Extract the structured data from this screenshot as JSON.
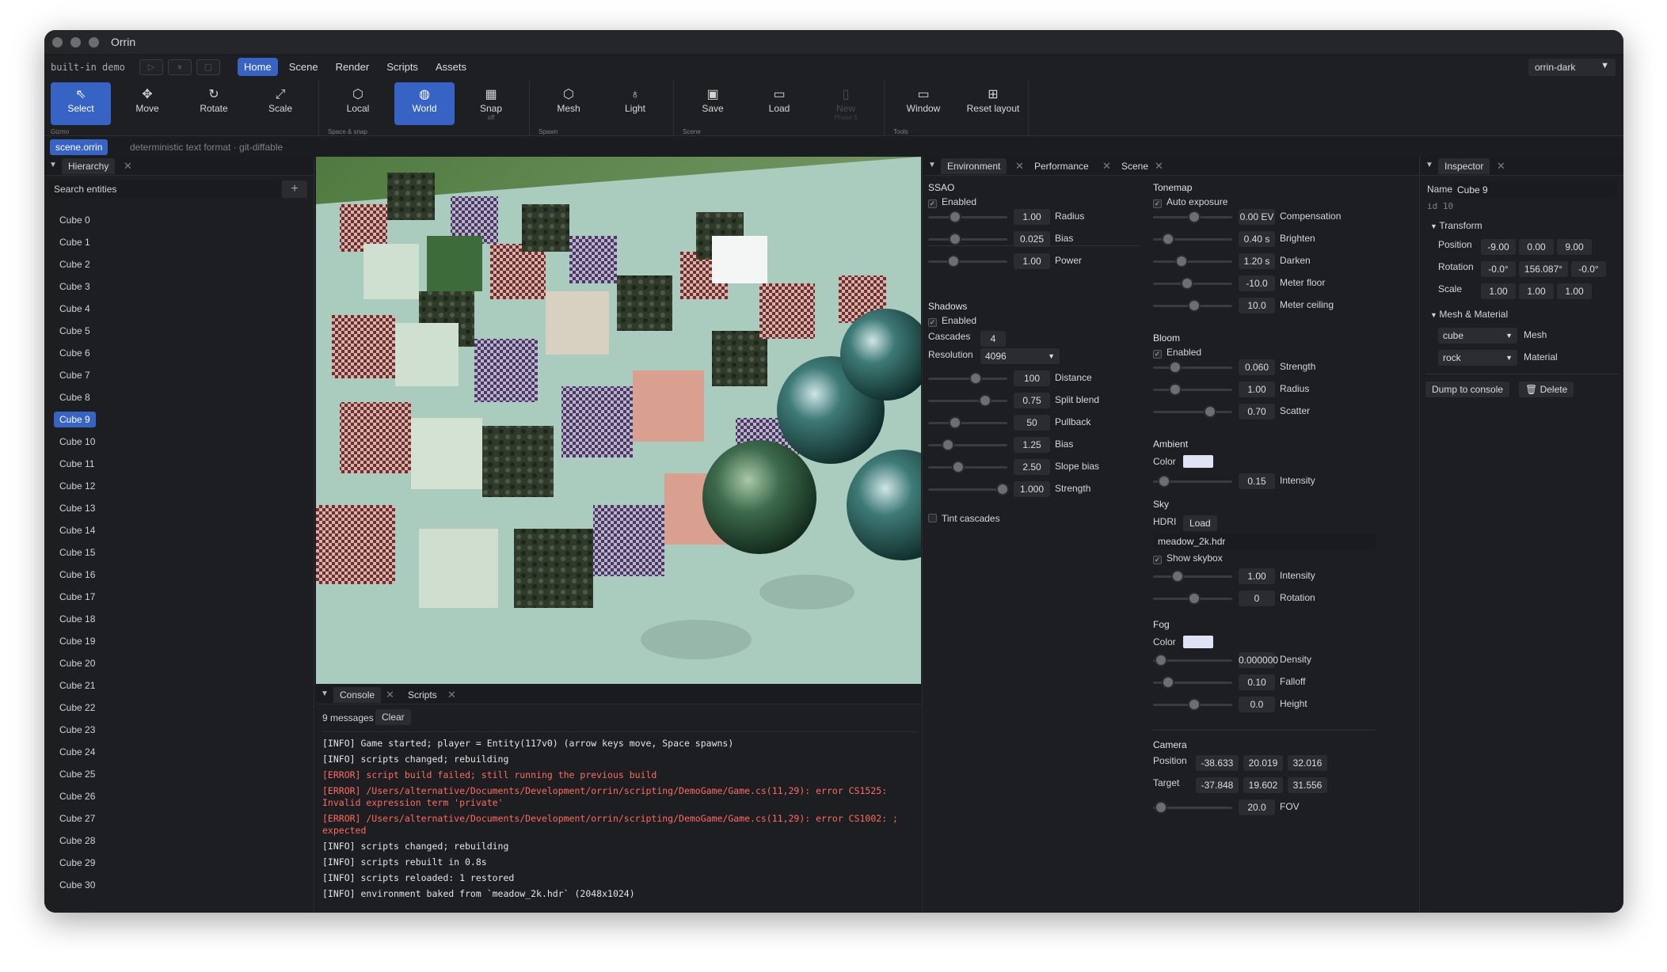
{
  "window": {
    "title": "Orrin"
  },
  "menubar": {
    "brand": "built-in demo",
    "menus": [
      "Home",
      "Scene",
      "Render",
      "Scripts",
      "Assets"
    ],
    "theme": "orrin-dark"
  },
  "ribbon": {
    "select": "Select",
    "move": "Move",
    "rotate": "Rotate",
    "scale": "Scale",
    "local": "Local",
    "world": "World",
    "snap": "Snap",
    "snap_sub": "off",
    "mesh": "Mesh",
    "light": "Light",
    "save": "Save",
    "load": "Load",
    "new": "New",
    "new_sub": "Phase 5",
    "window": "Window",
    "reset_layout": "Reset layout",
    "groups": {
      "gizmo": "Gizmo",
      "space": "Space & snap",
      "spawn": "Spawn",
      "scene": "Scene",
      "tools": "Tools"
    }
  },
  "filebar": {
    "tab": "scene.orrin",
    "note": "deterministic text format · git-diffable"
  },
  "hierarchy": {
    "tab": "Hierarchy",
    "search_placeholder": "Search entities",
    "items": [
      "Cube 0",
      "Cube 1",
      "Cube 2",
      "Cube 3",
      "Cube 4",
      "Cube 5",
      "Cube 6",
      "Cube 7",
      "Cube 8",
      "Cube 9",
      "Cube 10",
      "Cube 11",
      "Cube 12",
      "Cube 13",
      "Cube 14",
      "Cube 15",
      "Cube 16",
      "Cube 17",
      "Cube 18",
      "Cube 19",
      "Cube 20",
      "Cube 21",
      "Cube 22",
      "Cube 23",
      "Cube 24",
      "Cube 25",
      "Cube 26",
      "Cube 27",
      "Cube 28",
      "Cube 29",
      "Cube 30"
    ],
    "selected": "Cube 9"
  },
  "console": {
    "tabs": [
      "Console",
      "Scripts"
    ],
    "count": "9 messages",
    "clear": "Clear",
    "lines": [
      {
        "level": "info",
        "text": "[INFO] Game started; player = Entity(117v0) (arrow keys move, Space spawns)"
      },
      {
        "level": "info",
        "text": "[INFO] scripts changed; rebuilding"
      },
      {
        "level": "error",
        "text": "[ERROR] script build failed; still running the previous build"
      },
      {
        "level": "error",
        "text": "[ERROR] /Users/alternative/Documents/Development/orrin/scripting/DemoGame/Game.cs(11,29): error CS1525: Invalid expression term 'private'"
      },
      {
        "level": "error",
        "text": "[ERROR] /Users/alternative/Documents/Development/orrin/scripting/DemoGame/Game.cs(11,29): error CS1002: ; expected"
      },
      {
        "level": "info",
        "text": "[INFO] scripts changed; rebuilding"
      },
      {
        "level": "info",
        "text": "[INFO] scripts rebuilt in 0.8s"
      },
      {
        "level": "info",
        "text": "[INFO] scripts reloaded: 1 restored"
      },
      {
        "level": "info",
        "text": "[INFO] environment baked from `meadow_2k.hdr` (2048x1024)"
      }
    ]
  },
  "environment": {
    "tabs": [
      "Environment",
      "Performance",
      "Scene"
    ],
    "ssao": {
      "title": "SSAO",
      "enabled": "Enabled",
      "sliders": [
        {
          "label": "Radius",
          "value": "1.00",
          "pos": 0.28
        },
        {
          "label": "Bias",
          "value": "0.025",
          "pos": 0.28
        },
        {
          "label": "Power",
          "value": "1.00",
          "pos": 0.26
        }
      ]
    },
    "shadows": {
      "title": "Shadows",
      "enabled": "Enabled",
      "cascades_label": "Cascades",
      "cascades": "4",
      "resolution_label": "Resolution",
      "resolution": "4096",
      "sliders": [
        {
          "label": "Distance",
          "value": "100",
          "pos": 0.56
        },
        {
          "label": "Split blend",
          "value": "0.75",
          "pos": 0.7
        },
        {
          "label": "Pullback",
          "value": "50",
          "pos": 0.28
        },
        {
          "label": "Bias",
          "value": "1.25",
          "pos": 0.18
        },
        {
          "label": "Slope bias",
          "value": "2.50",
          "pos": 0.33
        },
        {
          "label": "Strength",
          "value": "1.000",
          "pos": 0.93
        }
      ],
      "tint": "Tint cascades"
    },
    "tonemap": {
      "title": "Tonemap",
      "auto": "Auto exposure",
      "sliders": [
        {
          "label": "Compensation",
          "value": "0.00 EV",
          "pos": 0.48
        },
        {
          "label": "Brighten",
          "value": "0.40 s",
          "pos": 0.12
        },
        {
          "label": "Darken",
          "value": "1.20 s",
          "pos": 0.3
        },
        {
          "label": "Meter floor",
          "value": "-10.0",
          "pos": 0.38
        },
        {
          "label": "Meter ceiling",
          "value": "10.0",
          "pos": 0.48
        }
      ]
    },
    "bloom": {
      "title": "Bloom",
      "enabled": "Enabled",
      "sliders": [
        {
          "label": "Strength",
          "value": "0.060",
          "pos": 0.22
        },
        {
          "label": "Radius",
          "value": "1.00",
          "pos": 0.22
        },
        {
          "label": "Scatter",
          "value": "0.70",
          "pos": 0.7
        }
      ]
    },
    "ambient": {
      "title": "Ambient",
      "color_label": "Color",
      "color": "#dfe3f5",
      "intensity": {
        "label": "Intensity",
        "value": "0.15",
        "pos": 0.07
      }
    },
    "sky": {
      "title": "Sky",
      "hdri_label": "HDRI",
      "load": "Load",
      "file": "meadow_2k.hdr",
      "show": "Show skybox",
      "sliders": [
        {
          "label": "Intensity",
          "value": "1.00",
          "pos": 0.25
        },
        {
          "label": "Rotation",
          "value": "0",
          "pos": 0.48
        }
      ]
    },
    "fog": {
      "title": "Fog",
      "color_label": "Color",
      "color": "#dfe3f5",
      "sliders": [
        {
          "label": "Density",
          "value": "0.000000",
          "pos": 0.02
        },
        {
          "label": "Falloff",
          "value": "0.10",
          "pos": 0.12
        },
        {
          "label": "Height",
          "value": "0.0",
          "pos": 0.48
        }
      ]
    },
    "camera": {
      "title": "Camera",
      "position_label": "Position",
      "position": [
        "-38.633",
        "20.019",
        "32.016"
      ],
      "target_label": "Target",
      "target": [
        "-37.848",
        "19.602",
        "31.556"
      ],
      "fov": {
        "label": "FOV",
        "value": "20.0",
        "pos": 0.02
      }
    }
  },
  "inspector": {
    "tab": "Inspector",
    "name_label": "Name",
    "name": "Cube 9",
    "id": "id 10",
    "transform": "Transform",
    "position_label": "Position",
    "position": [
      "-9.00",
      "0.00",
      "9.00"
    ],
    "rotation_label": "Rotation",
    "rotation": [
      "-0.0°",
      "156.087°",
      "-0.0°"
    ],
    "scale_label": "Scale",
    "scale": [
      "1.00",
      "1.00",
      "1.00"
    ],
    "mesh_material": "Mesh & Material",
    "mesh_label": "Mesh",
    "mesh": "cube",
    "material_label": "Material",
    "material": "rock",
    "dump": "Dump to console",
    "delete": "Delete"
  },
  "colors": {
    "accent": "#3763c4",
    "error": "#ff6a5e",
    "panel": "#1d1e21"
  }
}
